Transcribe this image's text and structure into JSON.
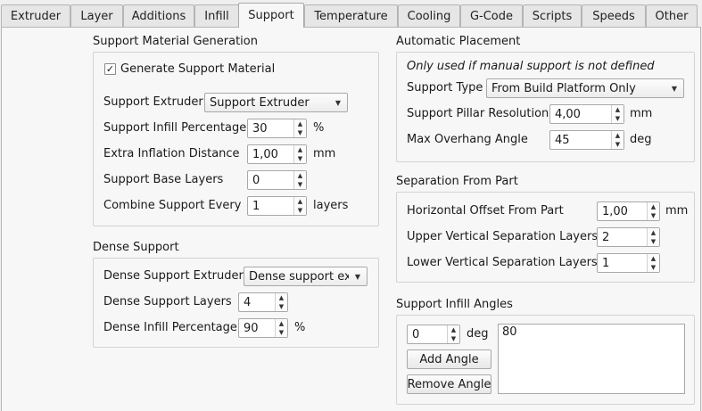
{
  "tabs": [
    {
      "label": "Extruder"
    },
    {
      "label": "Layer"
    },
    {
      "label": "Additions"
    },
    {
      "label": "Infill"
    },
    {
      "label": "Support"
    },
    {
      "label": "Temperature"
    },
    {
      "label": "Cooling"
    },
    {
      "label": "G-Code"
    },
    {
      "label": "Scripts"
    },
    {
      "label": "Speeds"
    },
    {
      "label": "Other"
    }
  ],
  "support_material": {
    "title": "Support Material Generation",
    "generate_label": "Generate Support Material",
    "generate_checked": true,
    "check_glyph": "✓",
    "extruder_label": "Support Extruder",
    "extruder_value": "Support Extruder",
    "infill_pct_label": "Support Infill Percentage",
    "infill_pct_value": "30",
    "infill_pct_unit": "%",
    "inflation_label": "Extra Inflation Distance",
    "inflation_value": "1,00",
    "inflation_unit": "mm",
    "base_layers_label": "Support Base Layers",
    "base_layers_value": "0",
    "combine_label": "Combine Support Every",
    "combine_value": "1",
    "combine_unit": "layers"
  },
  "dense_support": {
    "title": "Dense Support",
    "extruder_label": "Dense Support Extruder",
    "extruder_value": "Dense support extruder",
    "layers_label": "Dense Support Layers",
    "layers_value": "4",
    "infill_label": "Dense Infill Percentage",
    "infill_value": "90",
    "infill_unit": "%"
  },
  "automatic_placement": {
    "title": "Automatic Placement",
    "note": "Only used if manual support is not defined",
    "type_label": "Support Type",
    "type_value": "From Build Platform Only",
    "pillar_label": "Support Pillar Resolution",
    "pillar_value": "4,00",
    "pillar_unit": "mm",
    "overhang_label": "Max Overhang Angle",
    "overhang_value": "45",
    "overhang_unit": "deg"
  },
  "separation": {
    "title": "Separation From Part",
    "horizontal_label": "Horizontal Offset From Part",
    "horizontal_value": "1,00",
    "horizontal_unit": "mm",
    "upper_label": "Upper Vertical Separation Layers",
    "upper_value": "2",
    "lower_label": "Lower Vertical Separation Layers",
    "lower_value": "1"
  },
  "infill_angles": {
    "title": "Support Infill Angles",
    "angle_value": "0",
    "angle_unit": "deg",
    "add_label": "Add Angle",
    "remove_label": "Remove Angle",
    "angles": [
      "80"
    ]
  },
  "icons": {
    "spin_up": "▲",
    "spin_down": "▼",
    "dropdown": "▼"
  }
}
